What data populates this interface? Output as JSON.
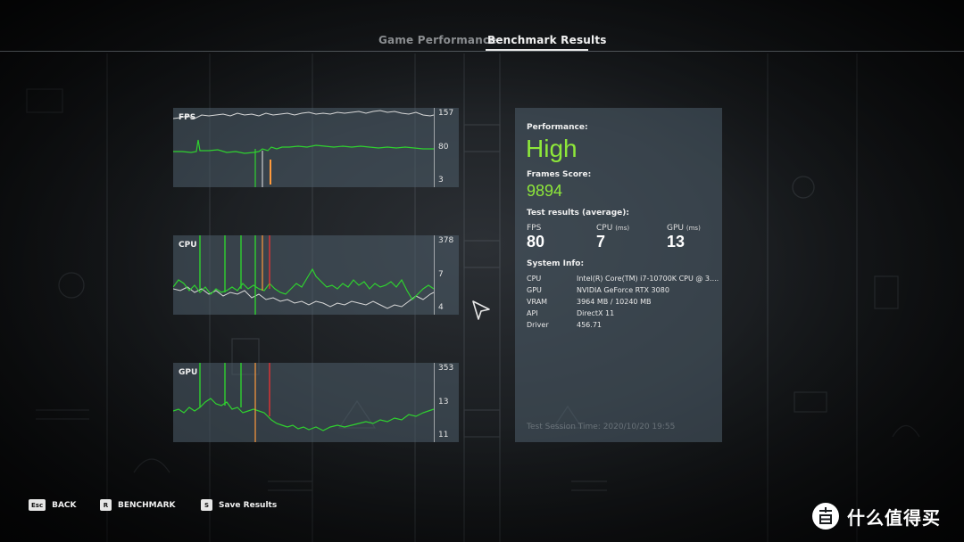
{
  "tabs": [
    {
      "label": "Game Performance",
      "active": false
    },
    {
      "label": "Benchmark Results",
      "active": true
    }
  ],
  "graphs": {
    "fps": {
      "title": "FPS",
      "ticks": [
        "157",
        "80",
        "3"
      ]
    },
    "cpu": {
      "title": "CPU",
      "ticks": [
        "378",
        "7",
        "4"
      ]
    },
    "gpu": {
      "title": "GPU",
      "ticks": [
        "353",
        "13",
        "11"
      ]
    }
  },
  "results": {
    "performance_label": "Performance:",
    "performance_value": "High",
    "frames_score_label": "Frames Score:",
    "frames_score_value": "9894",
    "test_results_label": "Test results (average):",
    "metrics": [
      {
        "name": "FPS",
        "unit": "",
        "value": "80"
      },
      {
        "name": "CPU",
        "unit": "(ms)",
        "value": "7"
      },
      {
        "name": "GPU",
        "unit": "(ms)",
        "value": "13"
      }
    ],
    "system_info_label": "System Info:",
    "system_info": [
      {
        "key": "CPU",
        "value": "Intel(R) Core(TM) i7-10700K CPU @ 3...."
      },
      {
        "key": "GPU",
        "value": "NVIDIA GeForce RTX 3080"
      },
      {
        "key": "VRAM",
        "value": "3964 MB / 10240 MB"
      },
      {
        "key": "API",
        "value": "DirectX 11"
      },
      {
        "key": "Driver",
        "value": "456.71"
      }
    ],
    "session_time": "Test Session Time: 2020/10/20 19:55"
  },
  "hints": [
    {
      "key": "Esc",
      "label": "BACK"
    },
    {
      "key": "R",
      "label": "BENCHMARK"
    },
    {
      "key": "S",
      "label": "Save Results"
    }
  ],
  "watermark": {
    "text": "什么值得买",
    "icon": "zhi-logo-icon"
  },
  "colors": {
    "accent_green": "#8ee83a",
    "line_green": "#2fd12f",
    "line_white": "#d8d8d8",
    "spike_orange": "#ff9a3c",
    "spike_red": "#ff3030",
    "panel_bg": "rgba(78,94,108,0.55)"
  }
}
